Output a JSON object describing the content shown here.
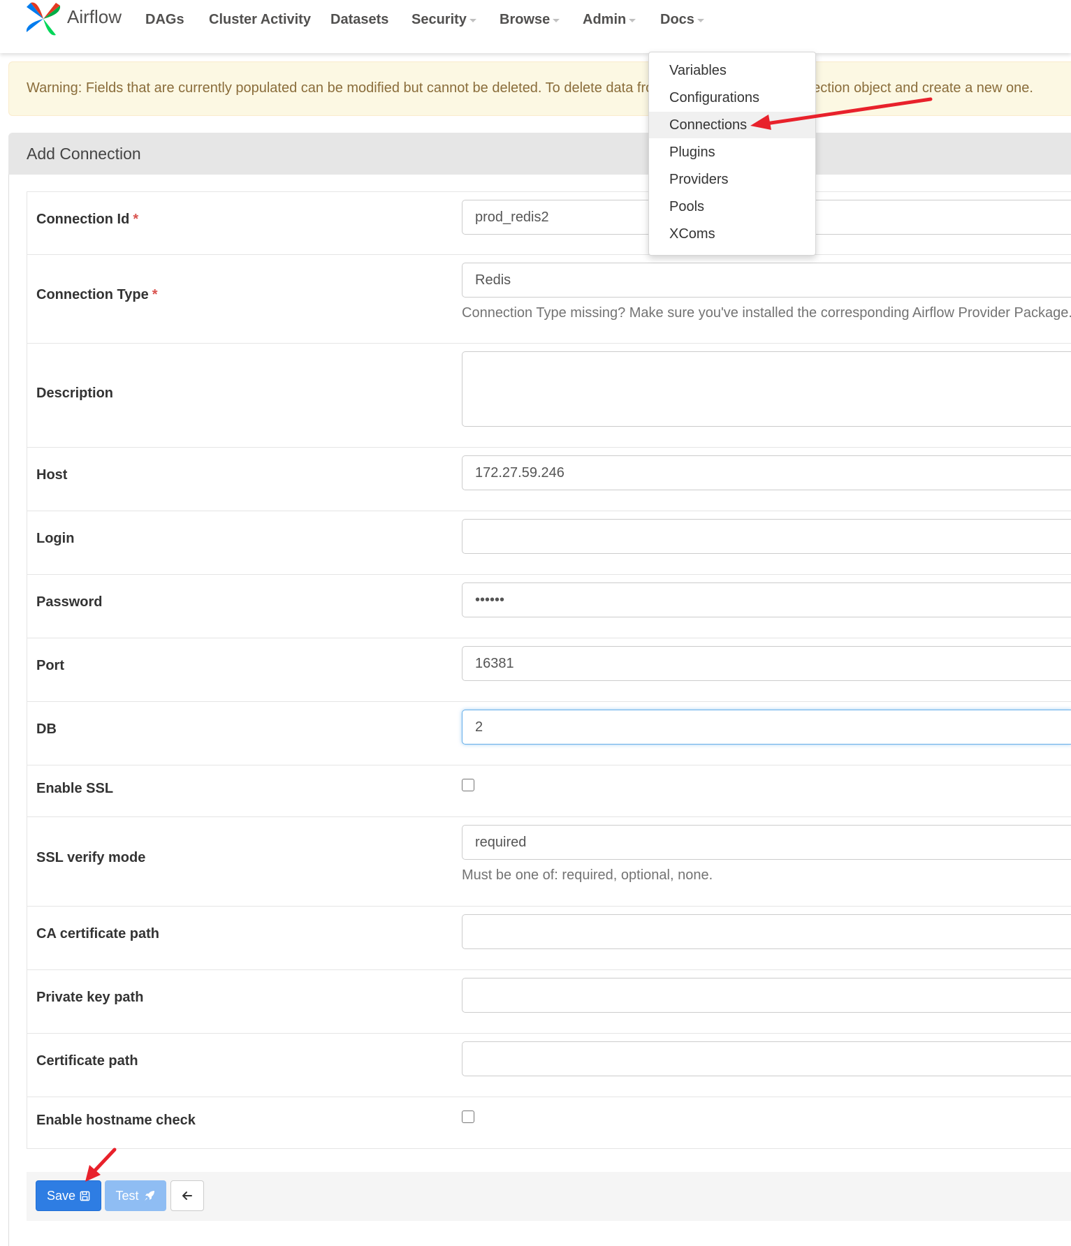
{
  "navbar": {
    "brand": "Airflow",
    "items": [
      {
        "label": "DAGs",
        "has_caret": false
      },
      {
        "label": "Cluster Activity",
        "has_caret": false
      },
      {
        "label": "Datasets",
        "has_caret": false
      },
      {
        "label": "Security",
        "has_caret": true
      },
      {
        "label": "Browse",
        "has_caret": true
      },
      {
        "label": "Admin",
        "has_caret": true
      },
      {
        "label": "Docs",
        "has_caret": true
      }
    ]
  },
  "admin_menu": {
    "items": [
      "Variables",
      "Configurations",
      "Connections",
      "Plugins",
      "Providers",
      "Pools",
      "XComs"
    ],
    "highlighted": "Connections"
  },
  "alert": {
    "text": "Warning: Fields that are currently populated can be modified but cannot be deleted. To delete data from a field, delete the Connection object and create a new one."
  },
  "panel": {
    "title": "Add Connection"
  },
  "form": {
    "connection_id": {
      "label": "Connection Id",
      "required": "*",
      "value": "prod_redis2"
    },
    "connection_type": {
      "label": "Connection Type",
      "required": "*",
      "value": "Redis",
      "help": "Connection Type missing? Make sure you've installed the corresponding Airflow Provider Package."
    },
    "description": {
      "label": "Description",
      "value": ""
    },
    "host": {
      "label": "Host",
      "value": "172.27.59.246"
    },
    "login": {
      "label": "Login",
      "value": ""
    },
    "password": {
      "label": "Password",
      "value": "••••••"
    },
    "port": {
      "label": "Port",
      "value": "16381"
    },
    "db": {
      "label": "DB",
      "value": "2"
    },
    "enable_ssl": {
      "label": "Enable SSL",
      "checked": false
    },
    "ssl_verify_mode": {
      "label": "SSL verify mode",
      "value": "required",
      "help": "Must be one of: required, optional, none."
    },
    "ca_certificate_path": {
      "label": "CA certificate path",
      "value": ""
    },
    "private_key_path": {
      "label": "Private key path",
      "value": ""
    },
    "certificate_path": {
      "label": "Certificate path",
      "value": ""
    },
    "enable_hostname_check": {
      "label": "Enable hostname check",
      "checked": false
    }
  },
  "actions": {
    "save_label": "Save",
    "test_label": "Test",
    "save_icon": "floppy-disk-icon",
    "test_icon": "rocket-icon",
    "back_icon": "arrow-left-icon"
  },
  "colors": {
    "primary": "#2e7de3",
    "annotation_arrow": "#e8212b",
    "warning_bg": "#fcf8e3",
    "warning_text": "#8a6d3b"
  }
}
